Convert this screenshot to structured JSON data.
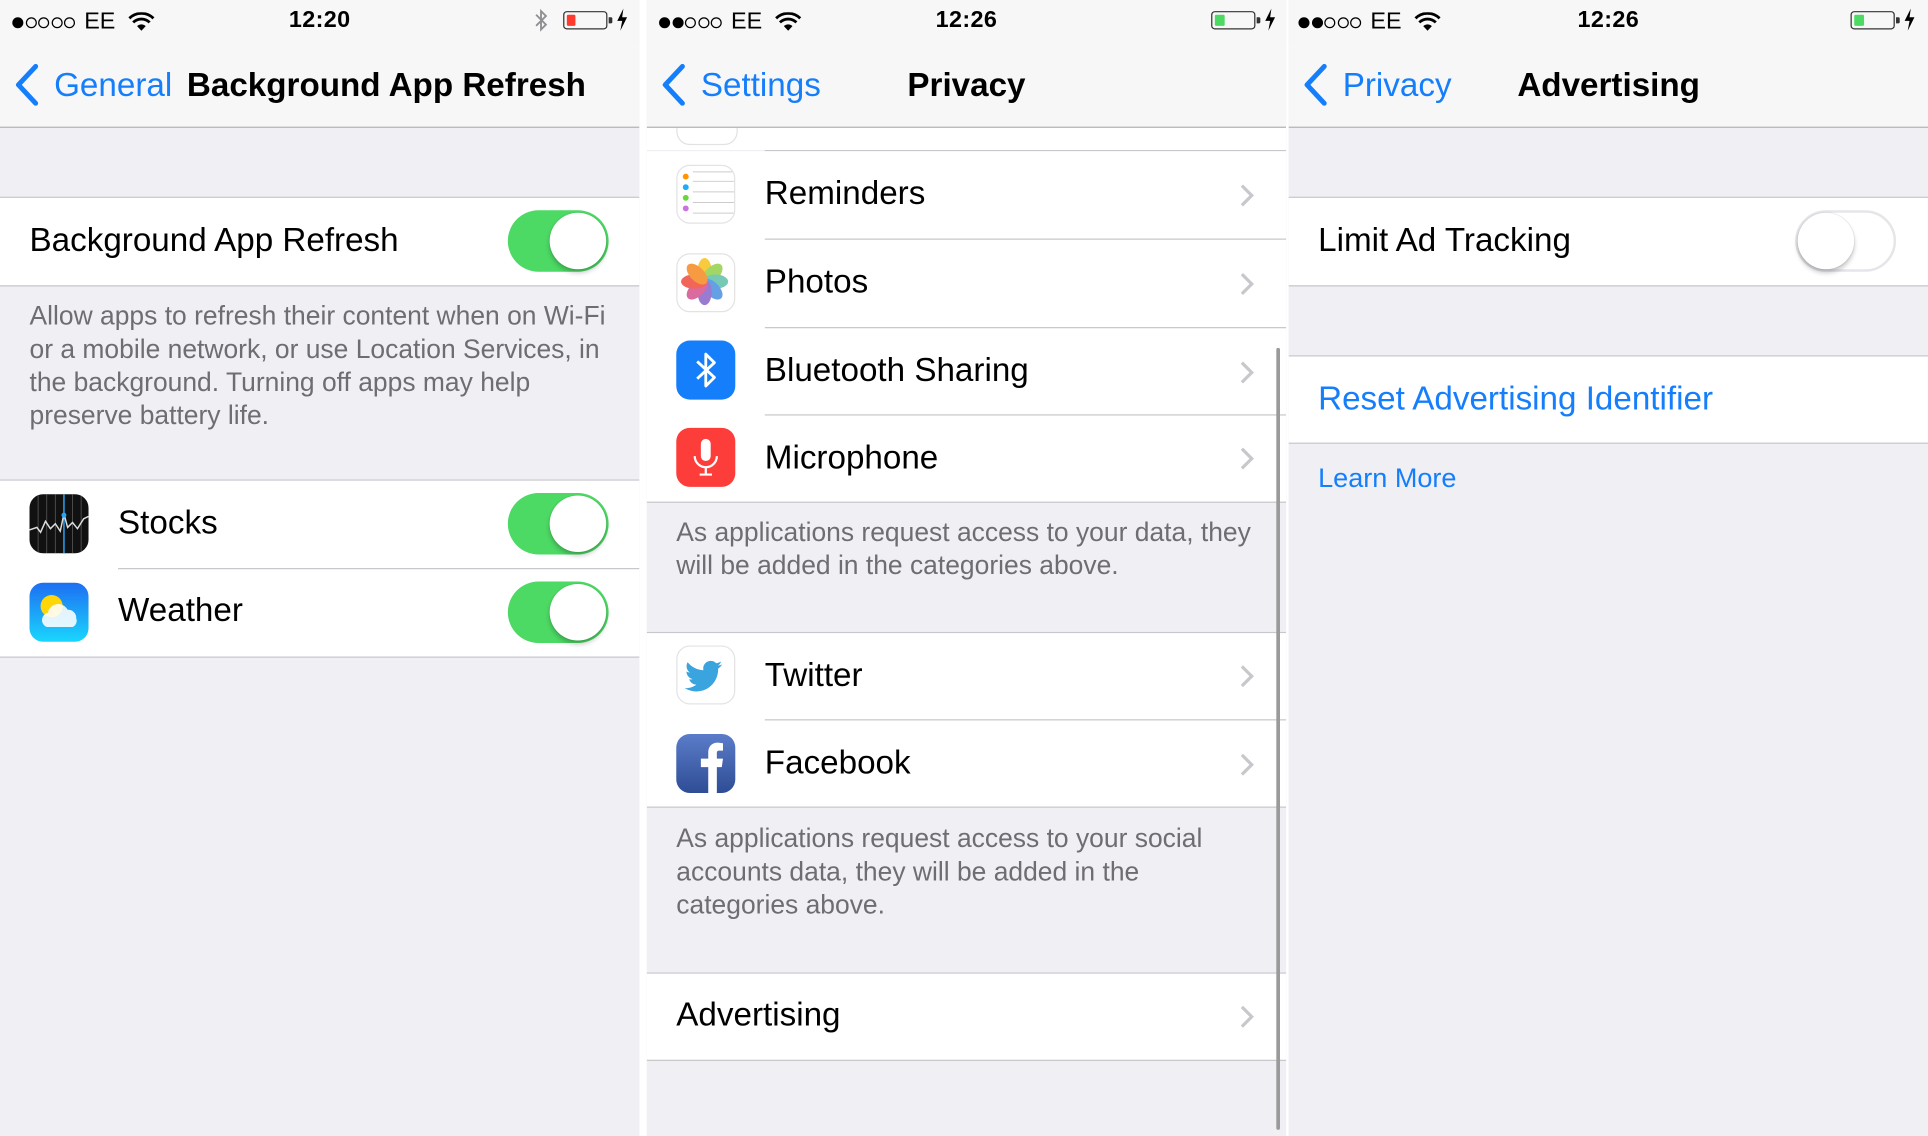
{
  "panels": [
    {
      "id": "background-app-refresh",
      "status": {
        "signal_bars": 1,
        "signal_total": 5,
        "carrier": "EE",
        "time": "12:20",
        "bluetooth": true,
        "battery_level": 0.15,
        "battery_color": "#ff3b30",
        "charging": true
      },
      "nav": {
        "back_label": "General",
        "title": "Background App Refresh"
      },
      "main_toggle": {
        "label": "Background App Refresh",
        "on": true
      },
      "footer": "Allow apps to refresh their content when on Wi-Fi or a mobile network, or use Location Services, in the background. Turning off apps may help preserve battery life.",
      "apps": [
        {
          "name": "Stocks",
          "icon": "stocks-icon",
          "on": true
        },
        {
          "name": "Weather",
          "icon": "weather-icon",
          "on": true
        }
      ]
    },
    {
      "id": "privacy",
      "status": {
        "signal_bars": 2,
        "signal_total": 5,
        "carrier": "EE",
        "time": "12:26",
        "bluetooth": false,
        "battery_level": 0.2,
        "battery_color": "#4cd964",
        "charging": true
      },
      "nav": {
        "back_label": "Settings",
        "title": "Privacy"
      },
      "data_items": [
        {
          "name": "Reminders",
          "icon": "reminders-icon"
        },
        {
          "name": "Photos",
          "icon": "photos-icon"
        },
        {
          "name": "Bluetooth Sharing",
          "icon": "bluetooth-icon"
        },
        {
          "name": "Microphone",
          "icon": "microphone-icon"
        }
      ],
      "data_footer": "As applications request access to your data, they will be added in the categories above.",
      "social_items": [
        {
          "name": "Twitter",
          "icon": "twitter-icon"
        },
        {
          "name": "Facebook",
          "icon": "facebook-icon"
        }
      ],
      "social_footer": "As applications request access to your social accounts data, they will be added in the categories above.",
      "advertising_label": "Advertising"
    },
    {
      "id": "advertising",
      "status": {
        "signal_bars": 2,
        "signal_total": 5,
        "carrier": "EE",
        "time": "12:26",
        "bluetooth": false,
        "battery_level": 0.2,
        "battery_color": "#4cd964",
        "charging": true
      },
      "nav": {
        "back_label": "Privacy",
        "title": "Advertising"
      },
      "limit_ad_tracking": {
        "label": "Limit Ad Tracking",
        "on": false
      },
      "reset_label": "Reset Advertising Identifier",
      "learn_more_label": "Learn More"
    }
  ],
  "colors": {
    "accent": "#157efb",
    "switch_on": "#4cd964",
    "background": "#efeff4",
    "footer_text": "#6d6d72",
    "separator": "#c8c7cc"
  }
}
